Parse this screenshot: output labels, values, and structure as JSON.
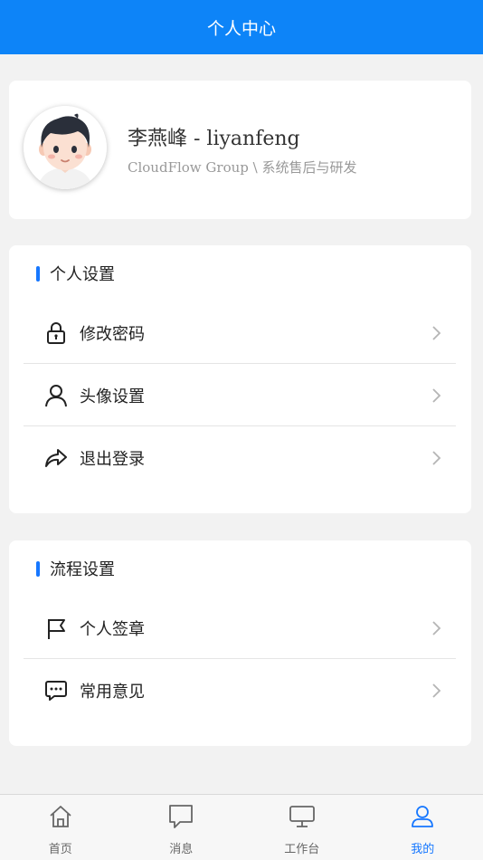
{
  "header": {
    "title": "个人中心"
  },
  "profile": {
    "name": "李燕峰 - liyanfeng",
    "org": "CloudFlow Group \\ 系统售后与研发"
  },
  "personal_settings": {
    "title": "个人设置",
    "items": [
      {
        "label": "修改密码",
        "icon": "lock-icon"
      },
      {
        "label": "头像设置",
        "icon": "user-icon"
      },
      {
        "label": "退出登录",
        "icon": "share-forward-icon"
      }
    ]
  },
  "process_settings": {
    "title": "流程设置",
    "items": [
      {
        "label": "个人签章",
        "icon": "flag-icon"
      },
      {
        "label": "常用意见",
        "icon": "comment-dots-icon"
      }
    ]
  },
  "tabbar": {
    "items": [
      {
        "label": "首页",
        "icon": "home-icon",
        "active": false
      },
      {
        "label": "消息",
        "icon": "message-icon",
        "active": false
      },
      {
        "label": "工作台",
        "icon": "monitor-icon",
        "active": false
      },
      {
        "label": "我的",
        "icon": "person-icon",
        "active": true
      }
    ]
  },
  "colors": {
    "header_bg": "#0d84f8",
    "accent": "#1677ff",
    "page_bg": "#f2f2f2"
  }
}
